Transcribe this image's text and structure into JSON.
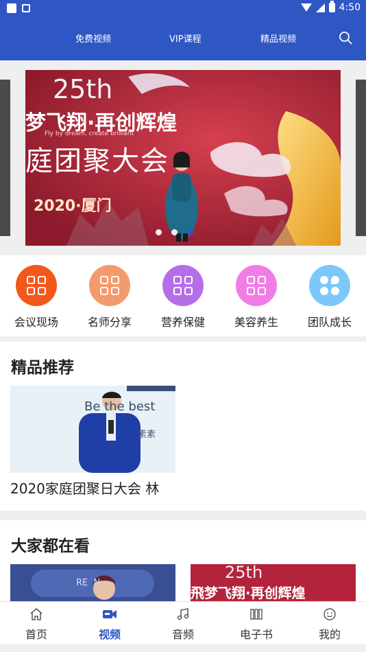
{
  "status_bar": {
    "time": "4:50"
  },
  "header": {
    "nav": [
      "免费视频",
      "VIP课程",
      "精品视频"
    ]
  },
  "banner": {
    "anniversary": "25th",
    "slogan": "梦飞翔·再创辉煌",
    "slogan_en": "Fly by dream, create brilliant",
    "title": "庭团聚大会",
    "city": "2020·厦门",
    "slide_count": 3,
    "active_slide": 3
  },
  "categories": [
    {
      "label": "会议现场",
      "color": "#f4571b",
      "icon": "grid-icon"
    },
    {
      "label": "名师分享",
      "color": "#f49a6c",
      "icon": "grid-icon"
    },
    {
      "label": "营养保健",
      "color": "#b56ee8",
      "icon": "grid-icon"
    },
    {
      "label": "美容养生",
      "color": "#f27ce6",
      "icon": "grid-icon"
    },
    {
      "label": "团队成长",
      "color": "#7ec7f9",
      "icon": "team-icon"
    }
  ],
  "sections": {
    "featured": {
      "title": "精品推荐",
      "items": [
        {
          "caption": "2020家庭团聚日大会  林",
          "thumb_text": "Be the best",
          "thumb_sub": "素素"
        }
      ]
    },
    "popular": {
      "title": "大家都在看",
      "items": [
        {
          "thumb_text": "RE  N"
        },
        {
          "thumb_text": "25th",
          "thumb_sub": "飛梦飞翔·再创辉煌"
        }
      ]
    }
  },
  "tabbar": {
    "tabs": [
      {
        "label": "首页",
        "icon": "home-icon"
      },
      {
        "label": "视频",
        "icon": "video-icon",
        "active": true
      },
      {
        "label": "音频",
        "icon": "music-note-icon"
      },
      {
        "label": "电子书",
        "icon": "book-icon"
      },
      {
        "label": "我的",
        "icon": "smiley-face-icon"
      }
    ]
  },
  "colors": {
    "brand": "#2f57c4",
    "banner_bg": "#b0243a"
  }
}
